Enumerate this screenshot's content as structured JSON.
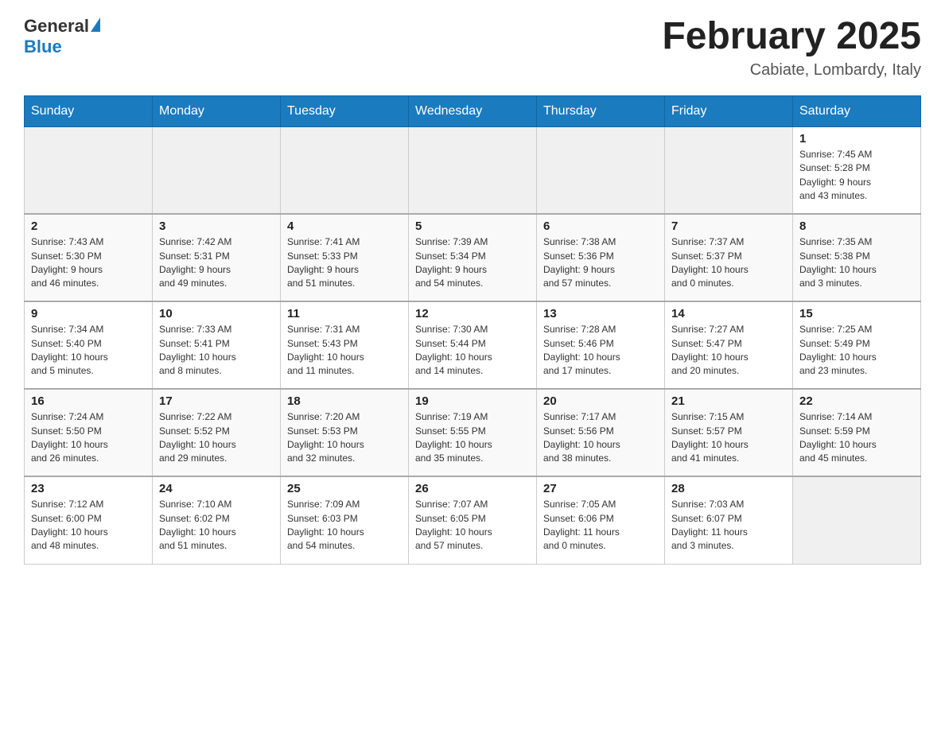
{
  "header": {
    "logo_general": "General",
    "logo_blue": "Blue",
    "month_title": "February 2025",
    "location": "Cabiate, Lombardy, Italy"
  },
  "days_of_week": [
    "Sunday",
    "Monday",
    "Tuesday",
    "Wednesday",
    "Thursday",
    "Friday",
    "Saturday"
  ],
  "weeks": [
    {
      "days": [
        {
          "num": "",
          "info": ""
        },
        {
          "num": "",
          "info": ""
        },
        {
          "num": "",
          "info": ""
        },
        {
          "num": "",
          "info": ""
        },
        {
          "num": "",
          "info": ""
        },
        {
          "num": "",
          "info": ""
        },
        {
          "num": "1",
          "info": "Sunrise: 7:45 AM\nSunset: 5:28 PM\nDaylight: 9 hours\nand 43 minutes."
        }
      ]
    },
    {
      "days": [
        {
          "num": "2",
          "info": "Sunrise: 7:43 AM\nSunset: 5:30 PM\nDaylight: 9 hours\nand 46 minutes."
        },
        {
          "num": "3",
          "info": "Sunrise: 7:42 AM\nSunset: 5:31 PM\nDaylight: 9 hours\nand 49 minutes."
        },
        {
          "num": "4",
          "info": "Sunrise: 7:41 AM\nSunset: 5:33 PM\nDaylight: 9 hours\nand 51 minutes."
        },
        {
          "num": "5",
          "info": "Sunrise: 7:39 AM\nSunset: 5:34 PM\nDaylight: 9 hours\nand 54 minutes."
        },
        {
          "num": "6",
          "info": "Sunrise: 7:38 AM\nSunset: 5:36 PM\nDaylight: 9 hours\nand 57 minutes."
        },
        {
          "num": "7",
          "info": "Sunrise: 7:37 AM\nSunset: 5:37 PM\nDaylight: 10 hours\nand 0 minutes."
        },
        {
          "num": "8",
          "info": "Sunrise: 7:35 AM\nSunset: 5:38 PM\nDaylight: 10 hours\nand 3 minutes."
        }
      ]
    },
    {
      "days": [
        {
          "num": "9",
          "info": "Sunrise: 7:34 AM\nSunset: 5:40 PM\nDaylight: 10 hours\nand 5 minutes."
        },
        {
          "num": "10",
          "info": "Sunrise: 7:33 AM\nSunset: 5:41 PM\nDaylight: 10 hours\nand 8 minutes."
        },
        {
          "num": "11",
          "info": "Sunrise: 7:31 AM\nSunset: 5:43 PM\nDaylight: 10 hours\nand 11 minutes."
        },
        {
          "num": "12",
          "info": "Sunrise: 7:30 AM\nSunset: 5:44 PM\nDaylight: 10 hours\nand 14 minutes."
        },
        {
          "num": "13",
          "info": "Sunrise: 7:28 AM\nSunset: 5:46 PM\nDaylight: 10 hours\nand 17 minutes."
        },
        {
          "num": "14",
          "info": "Sunrise: 7:27 AM\nSunset: 5:47 PM\nDaylight: 10 hours\nand 20 minutes."
        },
        {
          "num": "15",
          "info": "Sunrise: 7:25 AM\nSunset: 5:49 PM\nDaylight: 10 hours\nand 23 minutes."
        }
      ]
    },
    {
      "days": [
        {
          "num": "16",
          "info": "Sunrise: 7:24 AM\nSunset: 5:50 PM\nDaylight: 10 hours\nand 26 minutes."
        },
        {
          "num": "17",
          "info": "Sunrise: 7:22 AM\nSunset: 5:52 PM\nDaylight: 10 hours\nand 29 minutes."
        },
        {
          "num": "18",
          "info": "Sunrise: 7:20 AM\nSunset: 5:53 PM\nDaylight: 10 hours\nand 32 minutes."
        },
        {
          "num": "19",
          "info": "Sunrise: 7:19 AM\nSunset: 5:55 PM\nDaylight: 10 hours\nand 35 minutes."
        },
        {
          "num": "20",
          "info": "Sunrise: 7:17 AM\nSunset: 5:56 PM\nDaylight: 10 hours\nand 38 minutes."
        },
        {
          "num": "21",
          "info": "Sunrise: 7:15 AM\nSunset: 5:57 PM\nDaylight: 10 hours\nand 41 minutes."
        },
        {
          "num": "22",
          "info": "Sunrise: 7:14 AM\nSunset: 5:59 PM\nDaylight: 10 hours\nand 45 minutes."
        }
      ]
    },
    {
      "days": [
        {
          "num": "23",
          "info": "Sunrise: 7:12 AM\nSunset: 6:00 PM\nDaylight: 10 hours\nand 48 minutes."
        },
        {
          "num": "24",
          "info": "Sunrise: 7:10 AM\nSunset: 6:02 PM\nDaylight: 10 hours\nand 51 minutes."
        },
        {
          "num": "25",
          "info": "Sunrise: 7:09 AM\nSunset: 6:03 PM\nDaylight: 10 hours\nand 54 minutes."
        },
        {
          "num": "26",
          "info": "Sunrise: 7:07 AM\nSunset: 6:05 PM\nDaylight: 10 hours\nand 57 minutes."
        },
        {
          "num": "27",
          "info": "Sunrise: 7:05 AM\nSunset: 6:06 PM\nDaylight: 11 hours\nand 0 minutes."
        },
        {
          "num": "28",
          "info": "Sunrise: 7:03 AM\nSunset: 6:07 PM\nDaylight: 11 hours\nand 3 minutes."
        },
        {
          "num": "",
          "info": ""
        }
      ]
    }
  ]
}
